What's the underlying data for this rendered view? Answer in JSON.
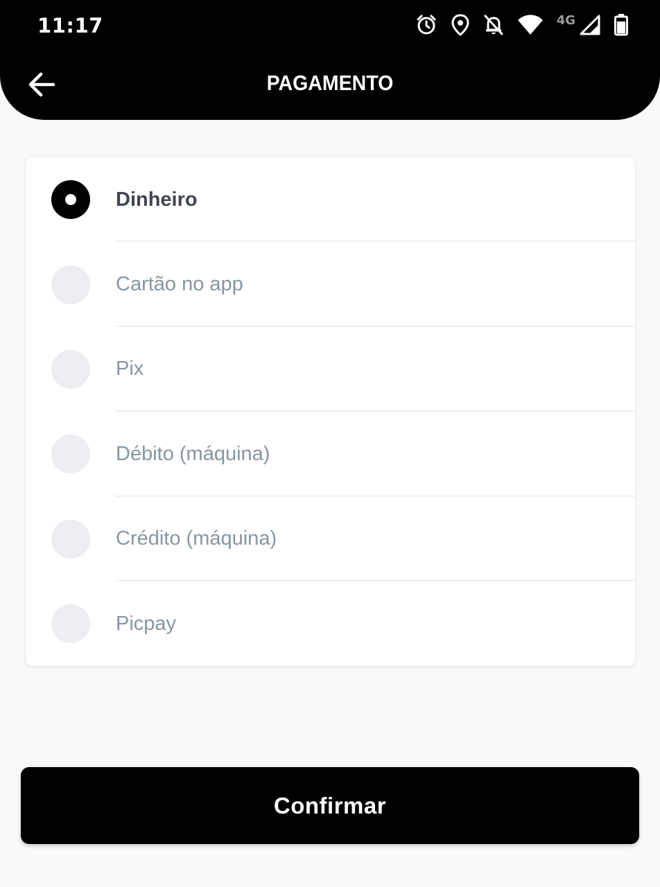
{
  "status_bar": {
    "time": "11:17",
    "network_label": "4G",
    "icons": [
      "alarm-icon",
      "location-icon",
      "notifications-off-icon",
      "wifi-icon",
      "signal-icon",
      "battery-icon"
    ]
  },
  "header": {
    "title": "PAGAMENTO",
    "back_icon": "arrow-left-icon"
  },
  "payment_options": [
    {
      "label": "Dinheiro",
      "selected": true
    },
    {
      "label": "Cartão no app",
      "selected": false
    },
    {
      "label": "Pix",
      "selected": false
    },
    {
      "label": "Débito (máquina)",
      "selected": false
    },
    {
      "label": "Crédito (máquina)",
      "selected": false
    },
    {
      "label": "Picpay",
      "selected": false
    }
  ],
  "confirm_button": {
    "label": "Confirmar"
  },
  "colors": {
    "header_bg": "#000000",
    "page_bg": "#f8f9f9",
    "selected_text": "#3f4552",
    "unselected_text": "#8597a1",
    "radio_unselected": "#eceef1",
    "button_bg": "#000000"
  }
}
